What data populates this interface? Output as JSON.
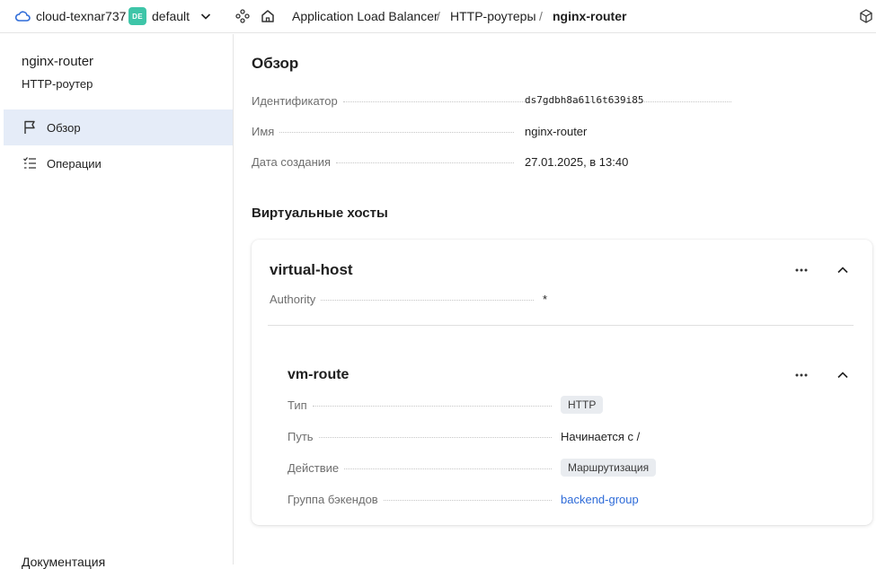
{
  "topbar": {
    "cloud_name": "cloud-texnar737",
    "folder_badge": "DE",
    "folder_name": "default",
    "breadcrumbs": [
      "Application Load Balancer",
      "HTTP-роутеры",
      "nginx-router"
    ],
    "separator": "/"
  },
  "sidebar": {
    "title": "nginx-router",
    "subtitle": "HTTP-роутер",
    "items": [
      {
        "label": "Обзор",
        "icon": "flag-icon",
        "active": true
      },
      {
        "label": "Операции",
        "icon": "checklist-icon",
        "active": false
      }
    ],
    "docs_label": "Документация"
  },
  "overview": {
    "heading": "Обзор",
    "fields": [
      {
        "key": "Идентификатор",
        "value": "ds7gdbh8a61l6t639i85"
      },
      {
        "key": "Имя",
        "value": "nginx-router"
      },
      {
        "key": "Дата создания",
        "value": "27.01.2025, в 13:40"
      }
    ]
  },
  "virtual_hosts": {
    "heading": "Виртуальные хосты",
    "host": {
      "name": "virtual-host",
      "authority_key": "Authority",
      "authority_value": "*",
      "route": {
        "name": "vm-route",
        "fields": [
          {
            "key": "Тип",
            "value": "HTTP"
          },
          {
            "key": "Путь",
            "value": "Начинается с /"
          },
          {
            "key": "Действие",
            "value": "Маршрутизация"
          },
          {
            "key": "Группа бэкендов",
            "value": "backend-group"
          }
        ]
      }
    }
  },
  "colors": {
    "accent": "#2e6bd8",
    "active_bg": "#e5ecf8",
    "folder_badge": "#3ec5a8",
    "badge_bg": "#e9ecf0"
  }
}
